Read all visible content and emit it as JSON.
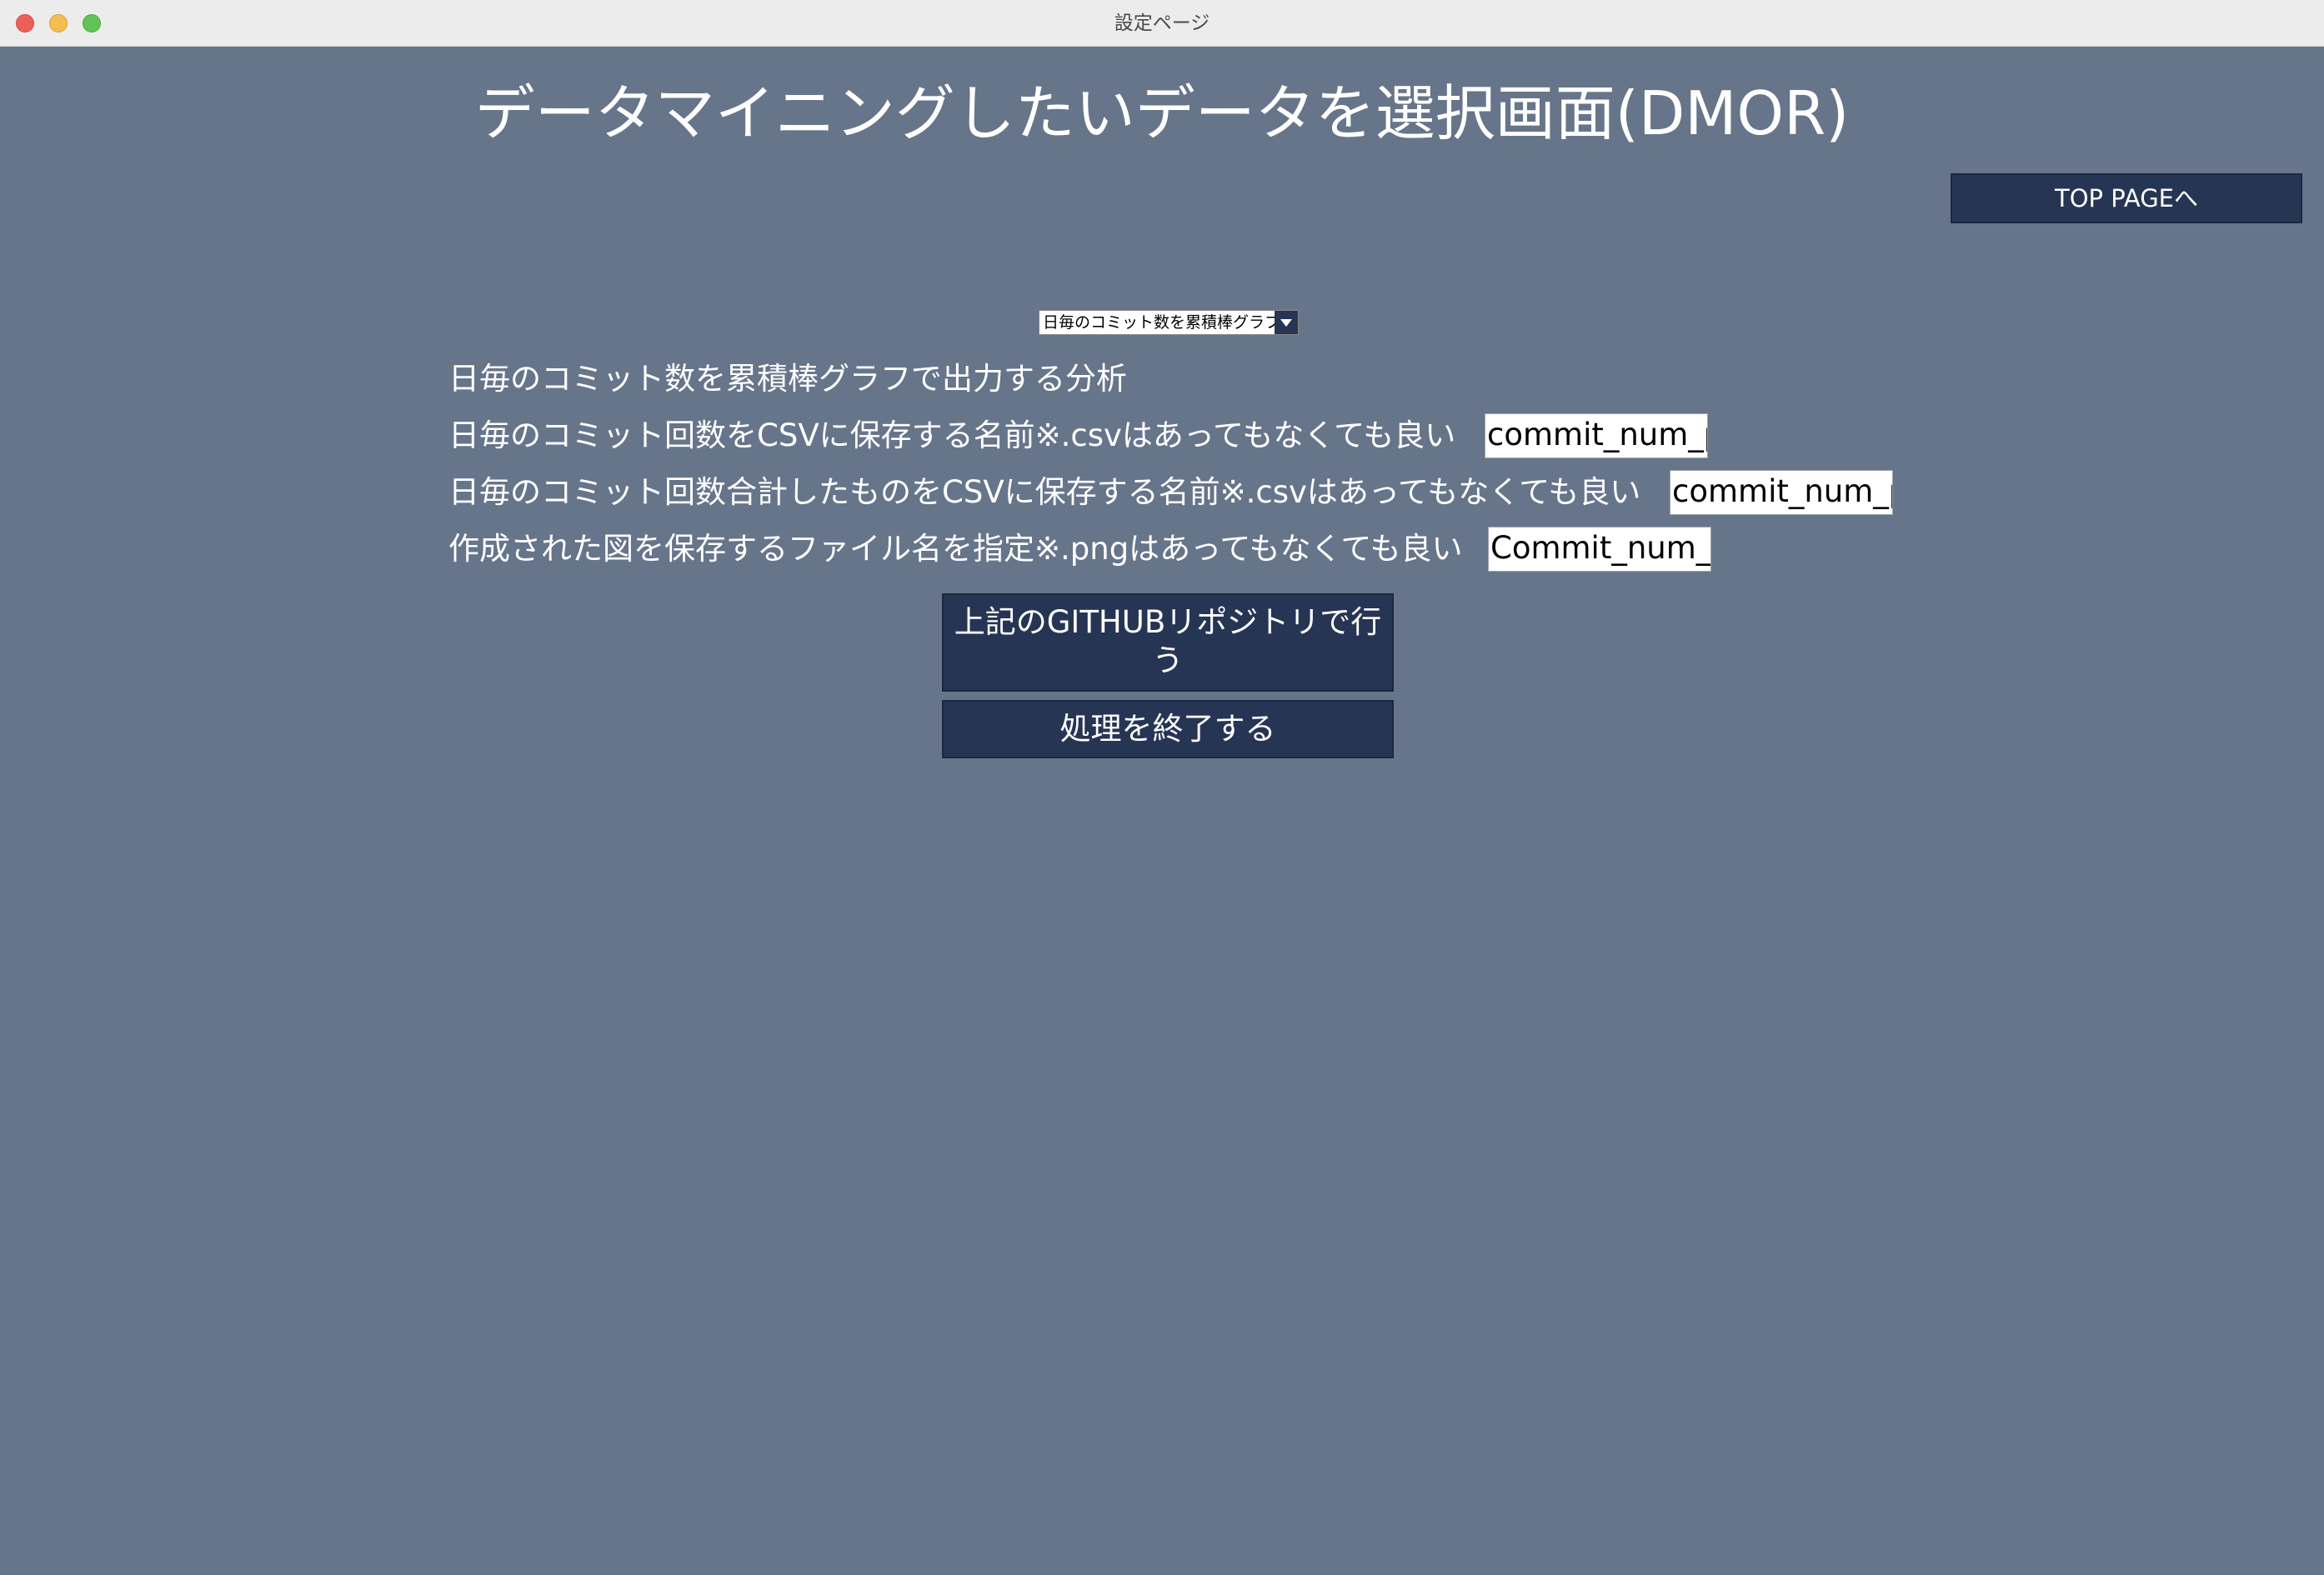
{
  "window": {
    "title": "設定ページ"
  },
  "header": {
    "title": "データマイニングしたいデータを選択画面(DMOR)",
    "top_page_button": "TOP PAGEへ"
  },
  "analysis_select": {
    "selected": "日毎のコミット数を累積棒グラフで出力する分析"
  },
  "form": {
    "description": "日毎のコミット数を累積棒グラフで出力する分析",
    "csv_label": "日毎のコミット回数をCSVに保存する名前※.csvはあってもなくても良い",
    "csv_value": "commit_num_per_day",
    "csv_sum_label": "日毎のコミット回数合計したものをCSVに保存する名前※.csvはあってもなくても良い",
    "csv_sum_value": "commit_num_per_day_sum",
    "png_label": "作成された図を保存するファイル名を指定※.pngはあってもなくても良い",
    "png_value": "Commit_num_chart"
  },
  "actions": {
    "run_label": "上記のGITHUBリポジトリで行う",
    "exit_label": "処理を終了する"
  }
}
